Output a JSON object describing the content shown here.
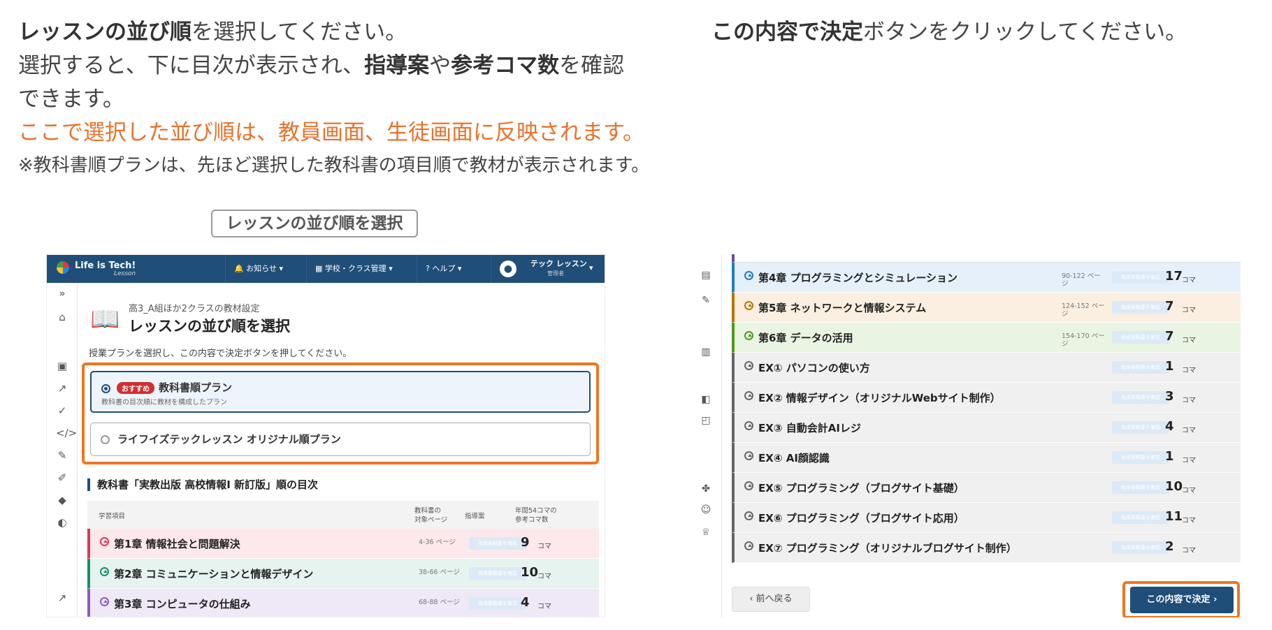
{
  "instructions_left": {
    "line1_bold": "レッスンの並び順",
    "line1_rest": "を選択してください。",
    "line2_pre": "選択すると、下に目次が表示され、",
    "line2_b1": "指導案",
    "line2_mid": "や",
    "line2_b2": "参考コマ数",
    "line2_post": "を確認",
    "line3": "できます。",
    "line4": "ここで選択した並び順は、教員画面、生徒画面に反映されます。",
    "line5": "※教科書順プランは、先ほど選択した教科書の項目順で教材が表示されます。"
  },
  "instructions_right": {
    "bold": "この内容で決定",
    "rest": "ボタンをクリックしてください。"
  },
  "label_box": "レッスンの並び順を選択",
  "app": {
    "logo_text": "Life is Tech!",
    "logo_sub": "Lesson",
    "nav_notice": "お知らせ",
    "nav_school": "学校・クラス管理",
    "nav_help": "ヘルプ",
    "user_name": "テック レッスン",
    "user_role": "管理者"
  },
  "page": {
    "subtitle": "高3_A組ほか2クラスの教材設定",
    "title": "レッスンの並び順を選択",
    "description": "授業プランを選択し、この内容で決定ボタンを押してください。",
    "option1_badge": "おすすめ",
    "option1_label": "教科書順プラン",
    "option1_sub": "教科書の目次順に教材を構成したプラン",
    "option2_label": "ライフイズテックレッスン オリジナル順プラン",
    "section_title": "教科書「実教出版 高校情報I 新訂版」順の目次",
    "col_item": "学習項目",
    "col_pages_1": "教科書の",
    "col_pages_2": "対象ページ",
    "col_guide": "指導案",
    "col_koma_1": "年間54コマの",
    "col_koma_2": "参考コマ数"
  },
  "koma_unit": "コマ",
  "guide_btn": "指導案概要を確認",
  "left_rows": [
    {
      "title": "第1章 情報社会と問題解決",
      "pages": "4-36 ページ",
      "koma": "9",
      "color": "#e0355a",
      "bg": "#fde8ec"
    },
    {
      "title": "第2章 コミュニケーションと情報デザイン",
      "pages": "38-66 ページ",
      "koma": "10",
      "color": "#16906a",
      "bg": "#e6f3ee"
    },
    {
      "title": "第3章 コンピュータの仕組み",
      "pages": "68-88 ページ",
      "koma": "4",
      "color": "#8e5bc0",
      "bg": "#efe8f6"
    }
  ],
  "right_rows": [
    {
      "title": "第4章 プログラミングとシミュレーション",
      "pages": "90-122 ページ",
      "koma": "17",
      "color": "#1e7fc4",
      "bg": "#e6f0fa"
    },
    {
      "title": "第5章 ネットワークと情報システム",
      "pages": "124-152 ページ",
      "koma": "7",
      "color": "#b8740a",
      "bg": "#fbefe1"
    },
    {
      "title": "第6章 データの活用",
      "pages": "154-170 ページ",
      "koma": "7",
      "color": "#4e9a1c",
      "bg": "#eaf4e3"
    },
    {
      "title": "EX① パソコンの使い方",
      "pages": "",
      "koma": "1",
      "color": "#666666",
      "bg": "#f0f0f0"
    },
    {
      "title": "EX② 情報デザイン（オリジナルWebサイト制作）",
      "pages": "",
      "koma": "3",
      "color": "#666666",
      "bg": "#f0f0f0"
    },
    {
      "title": "EX③ 自動会計AIレジ",
      "pages": "",
      "koma": "4",
      "color": "#666666",
      "bg": "#f0f0f0"
    },
    {
      "title": "EX④ AI顔認識",
      "pages": "",
      "koma": "1",
      "color": "#666666",
      "bg": "#f0f0f0"
    },
    {
      "title": "EX⑤ プログラミング（ブログサイト基礎）",
      "pages": "",
      "koma": "10",
      "color": "#666666",
      "bg": "#f0f0f0"
    },
    {
      "title": "EX⑥ プログラミング（ブログサイト応用）",
      "pages": "",
      "koma": "11",
      "color": "#666666",
      "bg": "#f0f0f0"
    },
    {
      "title": "EX⑦ プログラミング（オリジナルブログサイト制作）",
      "pages": "",
      "koma": "2",
      "color": "#666666",
      "bg": "#f0f0f0"
    }
  ],
  "back_button": "前へ戻る",
  "decide_button": "この内容で決定"
}
